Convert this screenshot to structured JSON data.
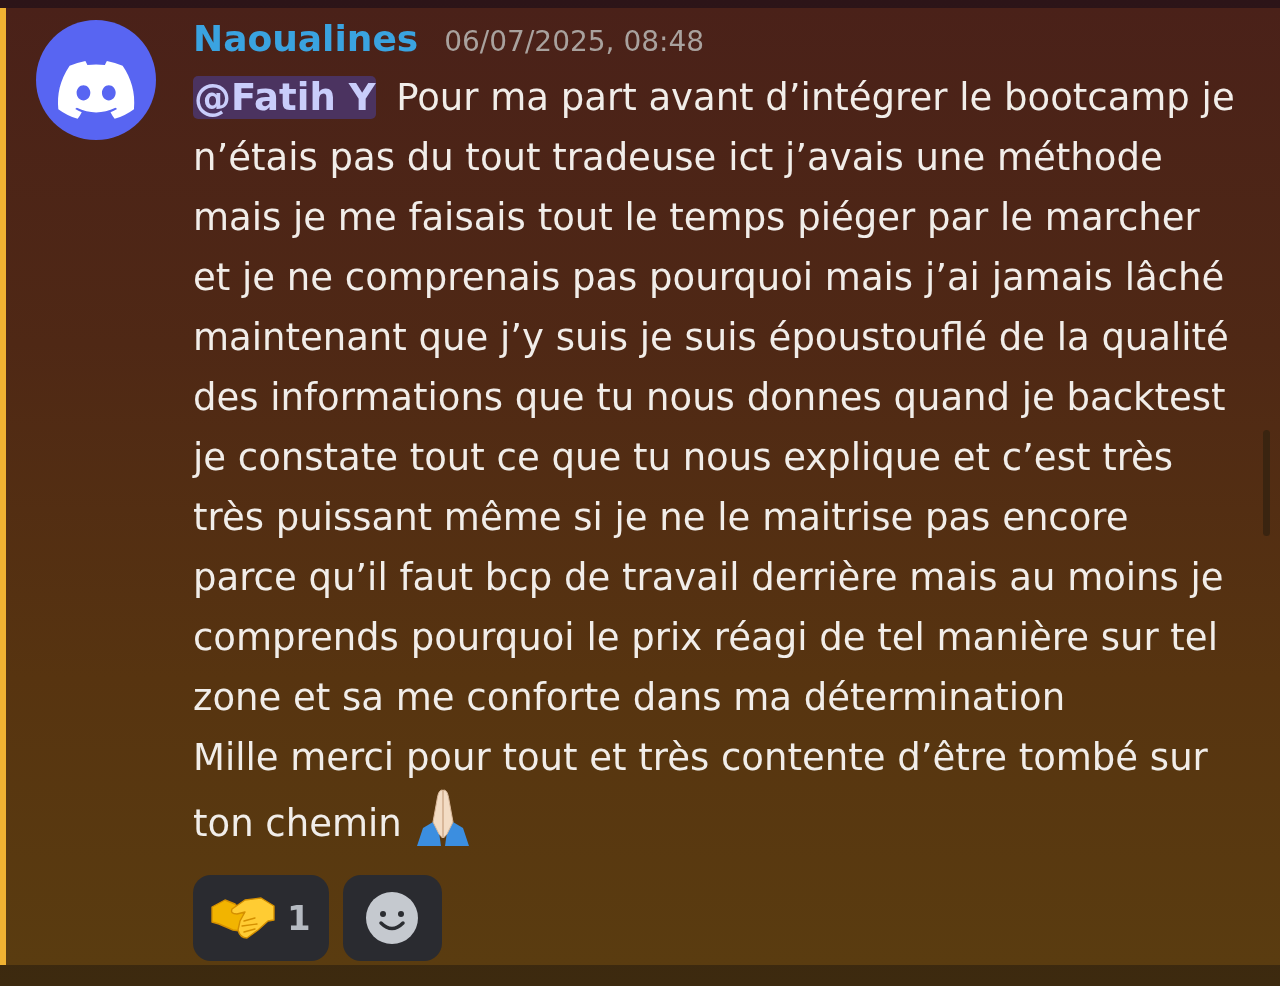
{
  "message": {
    "highlighted": true,
    "author": "Naoualines",
    "timestamp": "06/07/2025, 08:48",
    "mention": "@Fatih Y",
    "lines": [
      "Pour ma part avant d’intégrer le bootcamp je",
      "n’étais pas du tout tradeuse ict j’avais une méthode",
      "mais je me faisais tout le temps piéger par le marcher",
      "et je ne comprenais pas pourquoi mais j’ai jamais lâché",
      "maintenant que j’y suis je suis époustouflé de la qualité",
      "des informations que tu nous donnes quand je backtest",
      "je constate tout ce que tu nous explique et c’est très",
      "très puissant même si je ne le maitrise pas encore",
      "parce qu’il faut bcp de travail derrière mais au moins je",
      "comprends pourquoi le prix réagi de tel manière sur tel",
      "zone et sa me conforte dans ma détermination",
      "Mille merci pour tout et très contente d’être tombé sur",
      "ton chemin"
    ]
  },
  "reactions": [
    {
      "kind": "emoji",
      "count": "1"
    },
    {
      "kind": "add"
    }
  ]
}
